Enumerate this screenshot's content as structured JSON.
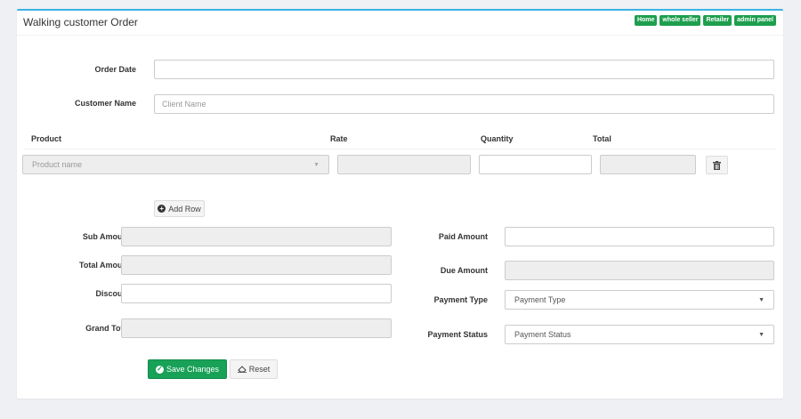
{
  "page": {
    "title": "Walking customer Order",
    "nav": [
      "Home",
      "whole seller",
      "Retailer",
      "admin panel"
    ]
  },
  "form": {
    "order_date_label": "Order Date",
    "order_date_value": "",
    "customer_name_label": "Customer Name",
    "customer_name_placeholder": "Client Name"
  },
  "products": {
    "headers": {
      "product": "Product",
      "rate": "Rate",
      "quantity": "Quantity",
      "total": "Total"
    },
    "rows": [
      {
        "product_placeholder": "Product name",
        "rate": "",
        "quantity": "",
        "total": ""
      }
    ],
    "add_row_label": "Add Row"
  },
  "summary": {
    "sub_amount_label": "Sub Amount",
    "total_amount_label": "Total Amount",
    "discount_label": "Discount",
    "grand_total_label": "Grand Total",
    "paid_amount_label": "Paid Amount",
    "due_amount_label": "Due Amount",
    "payment_type_label": "Payment Type",
    "payment_type_value": "Payment Type",
    "payment_status_label": "Payment Status",
    "payment_status_value": "Payment Status"
  },
  "actions": {
    "save_label": "Save Changes",
    "reset_label": "Reset"
  },
  "icons": {
    "add": "plus-circle-icon",
    "remove": "trash-icon",
    "save": "check-circle-icon",
    "reset": "eraser-icon"
  },
  "colors": {
    "accent": "#3bb3e4",
    "success": "#18a157",
    "badge": "#1e9f4e"
  }
}
